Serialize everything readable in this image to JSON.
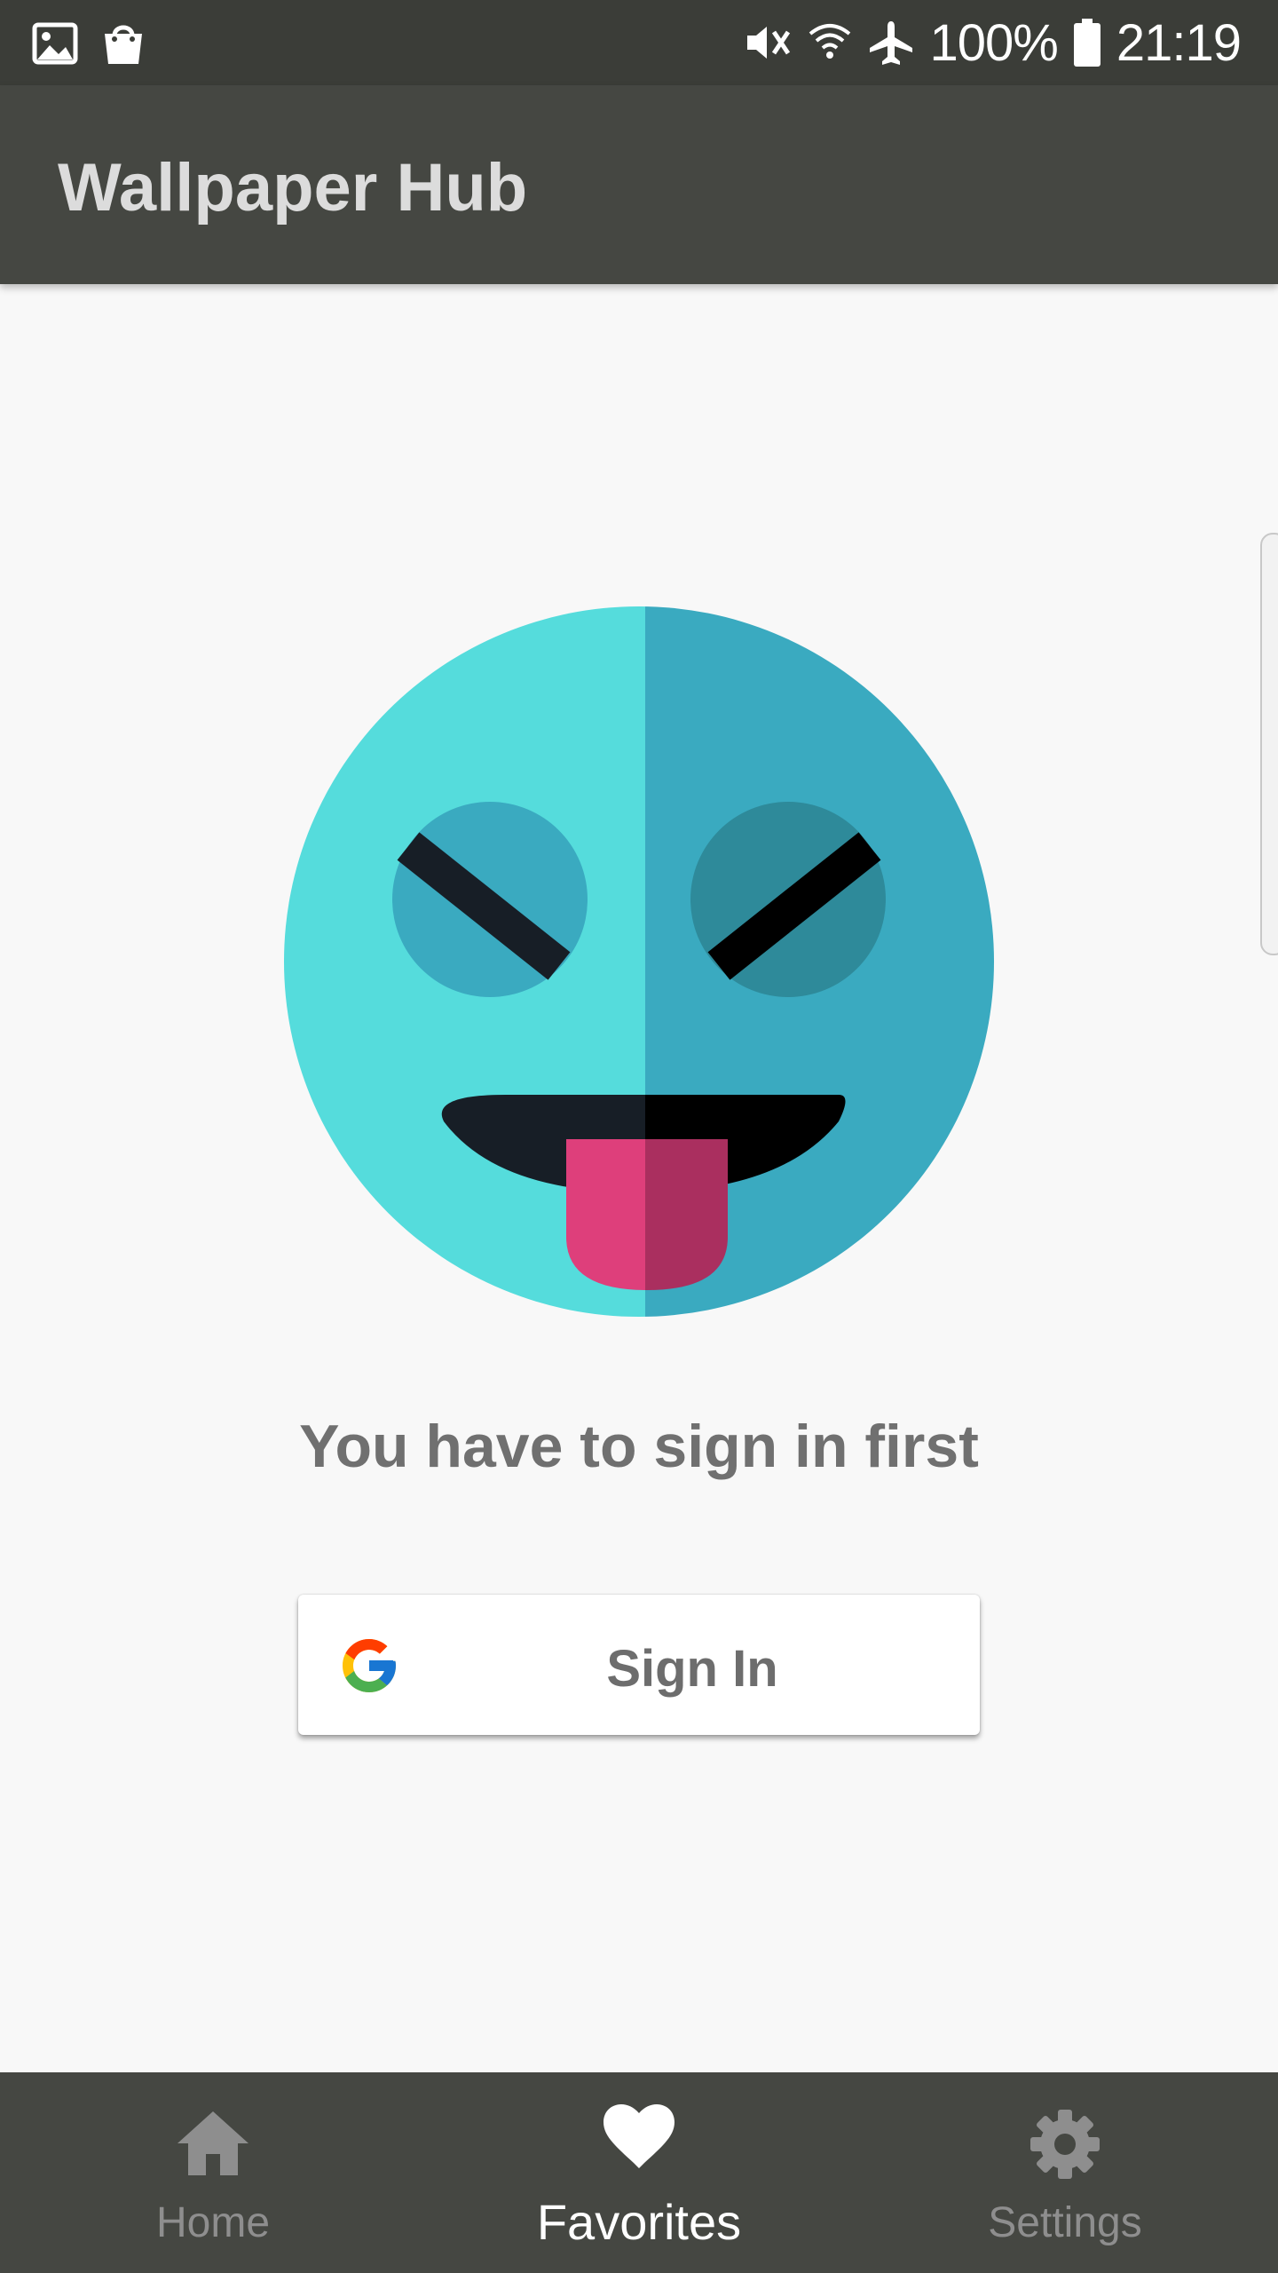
{
  "status_bar": {
    "left_icons": [
      "image-icon",
      "shopping-bag-icon"
    ],
    "right_icons": [
      "vibrate-mute-icon",
      "wifi-icon",
      "airplane-icon",
      "battery-icon"
    ],
    "battery": "100%",
    "time": "21:19"
  },
  "app_bar": {
    "title": "Wallpaper Hub"
  },
  "main": {
    "illustration": "tongue-out-emoji",
    "message": "You have to sign in first",
    "signin_button": {
      "label": "Sign In",
      "icon": "google-logo-icon"
    }
  },
  "bottom_nav": {
    "items": [
      {
        "label": "Home",
        "icon": "home-icon",
        "active": false
      },
      {
        "label": "Favorites",
        "icon": "heart-icon",
        "active": true
      },
      {
        "label": "Settings",
        "icon": "gear-icon",
        "active": false
      }
    ]
  },
  "colors": {
    "status_bar": "#3b3d38",
    "app_bar": "#454742",
    "background": "#f8f8f8",
    "emoji_light": "#55dcdc",
    "emoji_dark": "#3aaac0",
    "tongue": "#de3f7b",
    "nav_inactive": "#8e8e8e",
    "nav_active": "#ffffff"
  }
}
